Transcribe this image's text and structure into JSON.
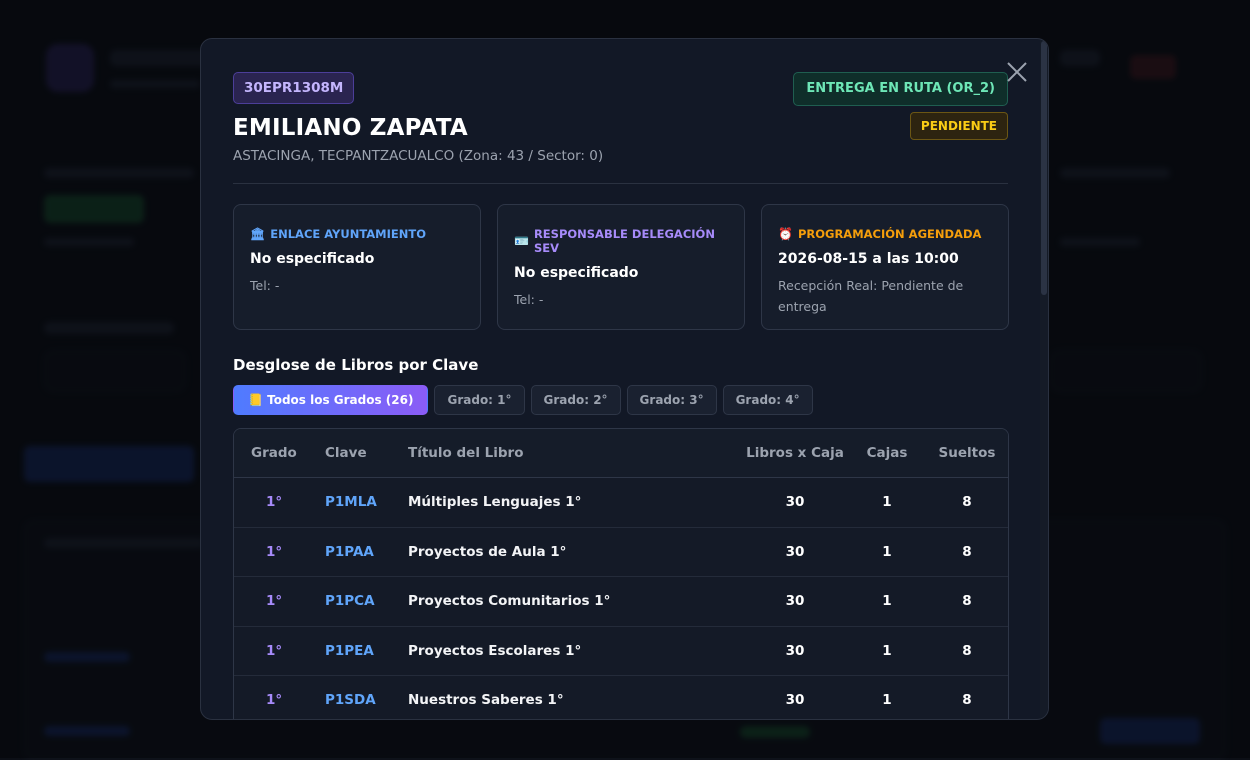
{
  "modal": {
    "code": "30EPR1308M",
    "route_badge": "ENTREGA EN RUTA (OR_2)",
    "status_badge": "PENDIENTE",
    "school_name": "EMILIANO ZAPATA",
    "location": "ASTACINGA, TECPANTZACUALCO (Zona: 43 / Sector: 0)",
    "close_icon": "close-icon"
  },
  "cards": [
    {
      "icon": "🏛",
      "icon_name": "building-icon",
      "title": "ENLACE AYUNTAMIENTO",
      "value": "No especificado",
      "sub": "Tel: -"
    },
    {
      "icon": "🪪",
      "icon_name": "id-badge-icon",
      "title": "RESPONSABLE DELEGACIÓN SEV",
      "value": "No especificado",
      "sub": "Tel: -"
    },
    {
      "icon": "⏰",
      "icon_name": "alarm-clock-icon",
      "title": "PROGRAMACIÓN AGENDADA",
      "value": "2026-08-15 a las 10:00",
      "sub": "Recepción Real: Pendiente de entrega"
    }
  ],
  "section_title": "Desglose de Libros por Clave",
  "filters": [
    {
      "label": "📒 Todos los Grados (26)",
      "active": true
    },
    {
      "label": "Grado: 1°",
      "active": false
    },
    {
      "label": "Grado: 2°",
      "active": false
    },
    {
      "label": "Grado: 3°",
      "active": false
    },
    {
      "label": "Grado: 4°",
      "active": false
    }
  ],
  "table": {
    "headers": [
      "Grado",
      "Clave",
      "Título del Libro",
      "Libros x Caja",
      "Cajas",
      "Sueltos"
    ],
    "rows": [
      {
        "grado": "1°",
        "clave": "P1MLA",
        "titulo": "Múltiples Lenguajes 1°",
        "libros_caja": "30",
        "cajas": "1",
        "sueltos": "8"
      },
      {
        "grado": "1°",
        "clave": "P1PAA",
        "titulo": "Proyectos de Aula 1°",
        "libros_caja": "30",
        "cajas": "1",
        "sueltos": "8"
      },
      {
        "grado": "1°",
        "clave": "P1PCA",
        "titulo": "Proyectos Comunitarios 1°",
        "libros_caja": "30",
        "cajas": "1",
        "sueltos": "8"
      },
      {
        "grado": "1°",
        "clave": "P1PEA",
        "titulo": "Proyectos Escolares 1°",
        "libros_caja": "30",
        "cajas": "1",
        "sueltos": "8"
      },
      {
        "grado": "1°",
        "clave": "P1SDA",
        "titulo": "Nuestros Saberes 1°",
        "libros_caja": "30",
        "cajas": "1",
        "sueltos": "8"
      }
    ]
  },
  "colors": {
    "accent_purple": "#a78bfa",
    "accent_blue": "#60a5fa",
    "accent_orange": "#f59e0b",
    "route_green": "#6ee7b7",
    "pending_yellow": "#facc15"
  }
}
